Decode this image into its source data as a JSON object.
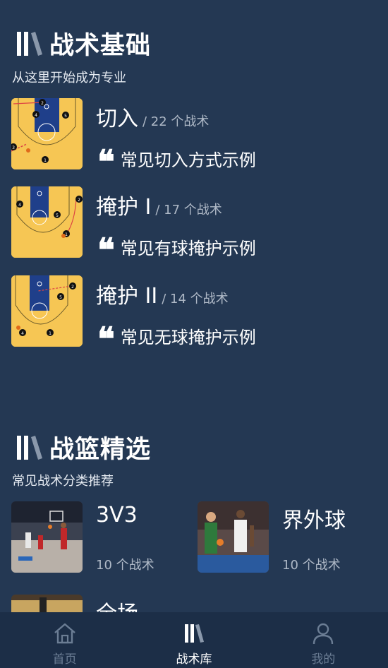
{
  "basics": {
    "title": "战术基础",
    "subtitle": "从这里开始成为专业",
    "items": [
      {
        "name": "切入",
        "count": "/ 22 个战术",
        "desc": "常见切入方式示例",
        "icon": "quote-icon"
      },
      {
        "name": "掩护 I",
        "count": "/ 17 个战术",
        "desc": "常见有球掩护示例",
        "icon": "quote-icon"
      },
      {
        "name": "掩护 II",
        "count": "/ 14 个战术",
        "desc": "常见无球掩护示例",
        "icon": "quote-icon"
      }
    ]
  },
  "featured": {
    "title": "战篮精选",
    "subtitle": "常见战术分类推荐",
    "categories": [
      {
        "name": "3V3",
        "count": "10 个战术"
      },
      {
        "name": "界外球",
        "count": "10 个战术"
      },
      {
        "name": "全场",
        "count": ""
      }
    ]
  },
  "tabbar": {
    "tabs": [
      {
        "label": "首页",
        "icon": "home-icon",
        "active": false
      },
      {
        "label": "战术库",
        "icon": "library-icon",
        "active": true
      },
      {
        "label": "我的",
        "icon": "profile-icon",
        "active": false
      }
    ],
    "active_color": "#ffffff",
    "inactive_color": "#6b7d94"
  },
  "colors": {
    "background": "#243853",
    "court": "#f6c654",
    "paint": "#1f3f8a"
  }
}
